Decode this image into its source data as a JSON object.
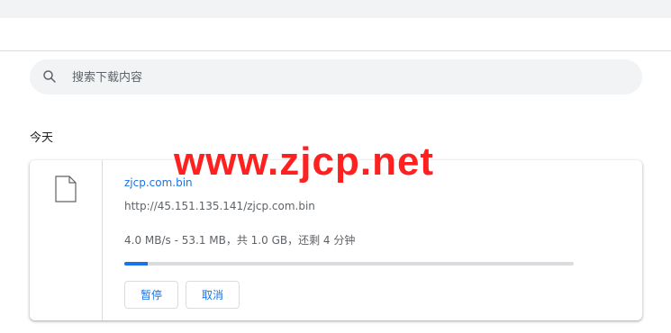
{
  "search": {
    "placeholder": "搜索下载内容"
  },
  "section": {
    "day_label": "今天"
  },
  "download": {
    "file_name": "zjcp.com.bin",
    "url": "http://45.151.135.141/zjcp.com.bin",
    "status": "4.0 MB/s - 53.1 MB，共 1.0 GB，还剩 4 分钟",
    "progress_fraction": 0.053,
    "pause_label": "暂停",
    "cancel_label": "取消"
  },
  "watermark": "www.zjcp.net",
  "colors": {
    "accent": "#1a73e8",
    "watermark": "#ff2020"
  },
  "icons": {
    "search": "search-icon",
    "file": "file-icon"
  }
}
